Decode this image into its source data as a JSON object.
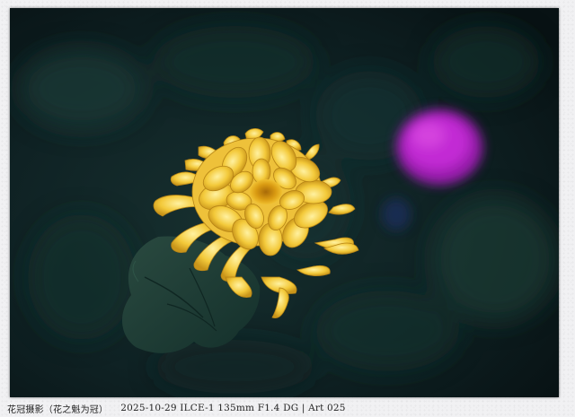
{
  "caption": {
    "author": "花冠摄影（花之魁为冠）",
    "meta": "2025-10-29 ILCE-1 135mm F1.4 DG | Art 025"
  },
  "colors": {
    "background_dark": "#0c1a1c",
    "flower_yellow": "#f3c93a",
    "flower_center": "#d99a12",
    "bokeh_magenta": "#b21fc8",
    "leaf_green": "#1f3d35"
  }
}
